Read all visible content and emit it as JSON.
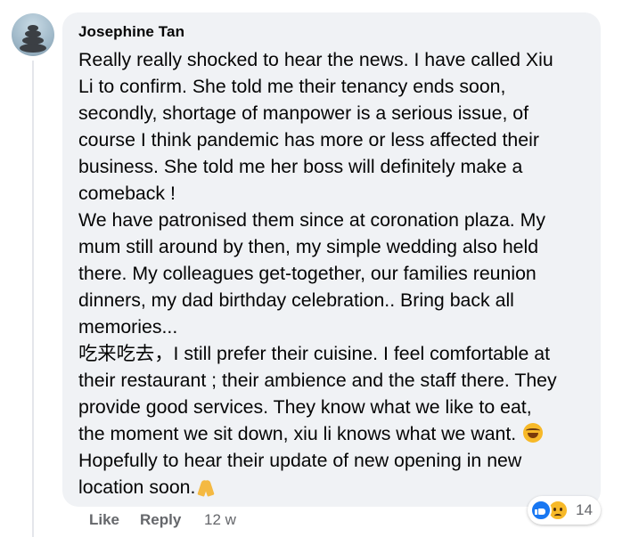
{
  "comment": {
    "author": "Josephine Tan",
    "avatar_icon": "stacked-stones-avatar",
    "lines": [
      "Really really shocked to hear the news. I have called Xiu",
      "Li to confirm. She told me their tenancy ends soon,",
      "secondly, shortage of manpower is a serious issue, of",
      "course I think pandemic has more or less affected their",
      "business. She told me her boss will definitely make a",
      "comeback !",
      "We have patronised them since at coronation plaza. My",
      "mum still around by then, my simple wedding also held",
      "there. My colleagues get-together, our families reunion",
      "dinners, my dad birthday celebration.. Bring back all",
      "memories...",
      "吃来吃去，I still prefer their cuisine. I feel comfortable at",
      "their restaurant ; their ambience and the staff there. They",
      "provide good services. They know what we like to eat,",
      "the moment we sit down, xiu li knows what we want.",
      "Hopefully to hear their update of new opening in new",
      "location soon."
    ],
    "inline_emojis": {
      "line_15": "laughing-tears-emoji",
      "line_17": "folded-hands-emoji"
    }
  },
  "reactions": {
    "icons": [
      "like-icon",
      "sad-icon"
    ],
    "count": "14"
  },
  "actions": {
    "like_label": "Like",
    "reply_label": "Reply",
    "time_label": "12 w"
  },
  "colors": {
    "bubble_bg": "#f0f2f5",
    "text": "#050505",
    "secondary_text": "#65676b",
    "like_blue": "#1877f2",
    "emoji_yellow": "#f7b928"
  }
}
